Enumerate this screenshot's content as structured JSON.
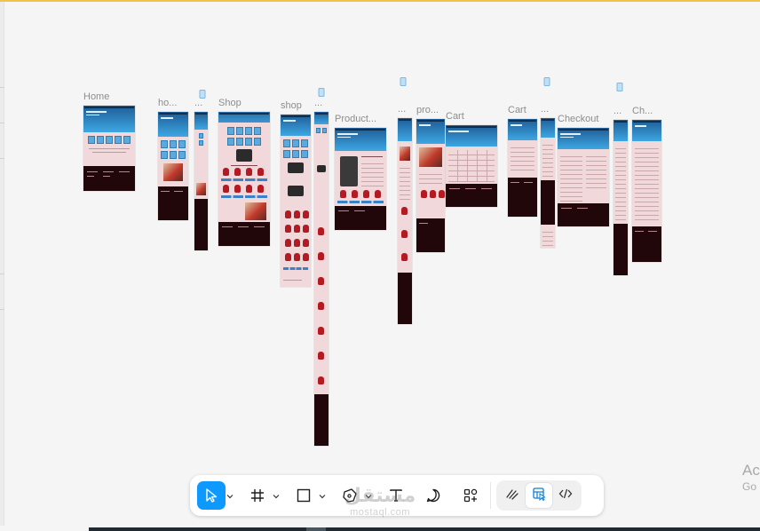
{
  "canvas": {
    "background": "#f5f5f5",
    "frame_labels": {
      "home": "Home",
      "home_tablet": "ho...",
      "home_mobile": "...",
      "shop": "Shop",
      "shop_tablet": "shop",
      "shop_mobile": "...",
      "product": "Product...",
      "product_mobile": "...",
      "product_tablet": "pro...",
      "cart": "Cart",
      "cart_tablet": "Cart",
      "cart_mobile": "...",
      "checkout": "Checkout",
      "checkout_mobile": "...",
      "checkout_tablet": "Ch..."
    }
  },
  "toolbar": {
    "tools": [
      {
        "name": "move-tool",
        "icon": "cursor-icon",
        "active": true
      },
      {
        "name": "frame-tool",
        "icon": "frame-icon"
      },
      {
        "name": "shape-tool",
        "icon": "rectangle-icon"
      },
      {
        "name": "pen-tool",
        "icon": "pen-icon"
      },
      {
        "name": "text-tool",
        "icon": "text-icon"
      },
      {
        "name": "comment-tool",
        "icon": "comment-icon"
      },
      {
        "name": "actions-tool",
        "icon": "actions-icon"
      }
    ],
    "modes": [
      {
        "name": "draw-mode",
        "icon": "draw-icon"
      },
      {
        "name": "design-mode",
        "icon": "design-icon",
        "active": true
      },
      {
        "name": "dev-mode",
        "icon": "code-icon"
      }
    ],
    "accent_color": "#0d99ff"
  },
  "watermark": {
    "arabic": "مستقل",
    "latin": "mostaql.com"
  },
  "os_notice": {
    "line1": "Ac",
    "line2": "Go"
  }
}
